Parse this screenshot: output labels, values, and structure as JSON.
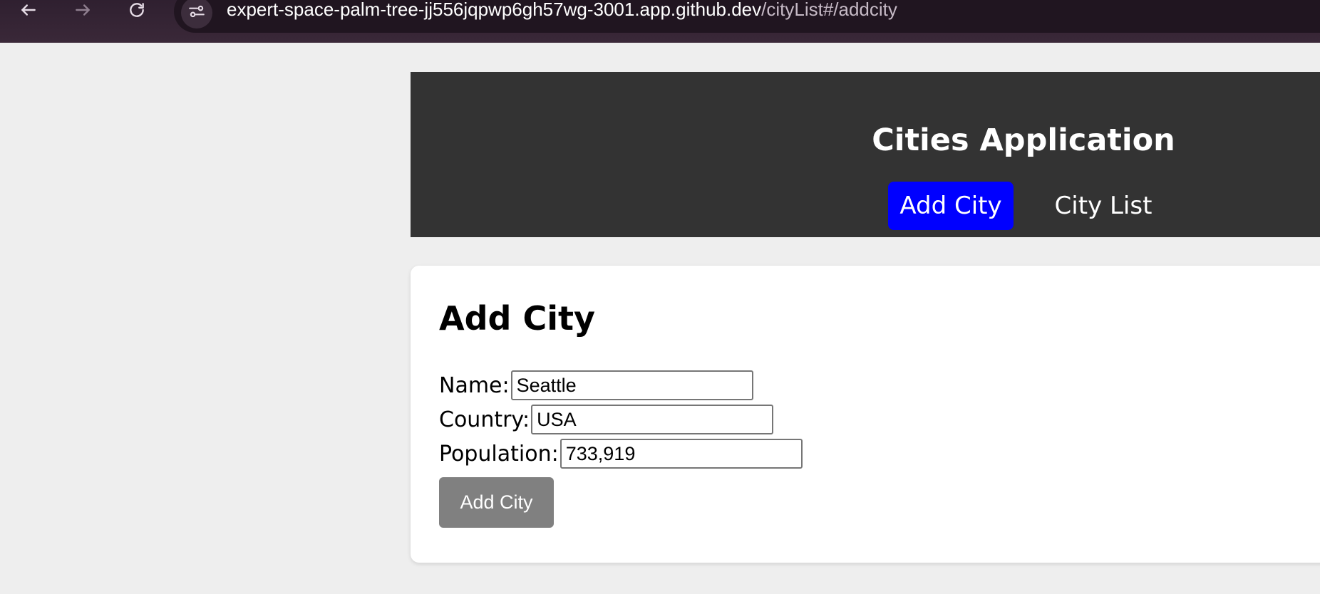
{
  "browser": {
    "url_host": "expert-space-palm-tree-jj556jqpwp6gh57wg-3001.app.github.dev",
    "url_path": "/cityList#/addcity",
    "icons": {
      "back": "arrow-left-icon",
      "forward": "arrow-right-icon",
      "reload": "reload-icon",
      "site_info": "tune-icon"
    }
  },
  "header": {
    "title": "Cities Application",
    "nav": [
      {
        "label": "Add City",
        "active": true
      },
      {
        "label": "City List",
        "active": false
      }
    ],
    "colors": {
      "background": "#333333",
      "active_link": "#0000ff"
    }
  },
  "main": {
    "title": "Add City",
    "form": {
      "name_label": "Name:",
      "name_value": "Seattle",
      "country_label": "Country:",
      "country_value": "USA",
      "population_label": "Population:",
      "population_value": "733,919",
      "submit_label": "Add City"
    }
  }
}
